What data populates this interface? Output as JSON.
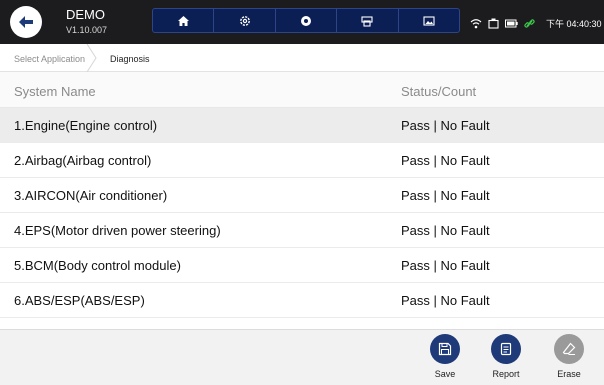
{
  "app": {
    "name": "DEMO",
    "version": "V1.10.007"
  },
  "toolbar": {
    "buttons": [
      {
        "name": "home-icon"
      },
      {
        "name": "settings-icon"
      },
      {
        "name": "record-icon"
      },
      {
        "name": "print-icon"
      },
      {
        "name": "screenshot-icon"
      }
    ]
  },
  "status_bar": {
    "icons": [
      "wifi-icon",
      "vci-icon",
      "battery-icon",
      "link-icon"
    ],
    "time": "下午 04:40:30"
  },
  "breadcrumb": [
    "Select Application",
    "Diagnosis"
  ],
  "table": {
    "headers": {
      "name": "System Name",
      "status": "Status/Count"
    },
    "rows": [
      {
        "name": "1.Engine(Engine control)",
        "status": "Pass | No Fault",
        "selected": true
      },
      {
        "name": "2.Airbag(Airbag control)",
        "status": "Pass | No Fault",
        "selected": false
      },
      {
        "name": "3.AIRCON(Air conditioner)",
        "status": "Pass | No Fault",
        "selected": false
      },
      {
        "name": "4.EPS(Motor driven power steering)",
        "status": "Pass | No Fault",
        "selected": false
      },
      {
        "name": "5.BCM(Body control module)",
        "status": "Pass | No Fault",
        "selected": false
      },
      {
        "name": "6.ABS/ESP(ABS/ESP)",
        "status": "Pass | No Fault",
        "selected": false
      }
    ]
  },
  "footer": {
    "save": "Save",
    "report": "Report",
    "erase": "Erase"
  },
  "colors": {
    "accent": "#1e3a78",
    "disabled": "#9a9a9a",
    "topbar": "#1c1c1e",
    "selected_row": "#ececec"
  }
}
